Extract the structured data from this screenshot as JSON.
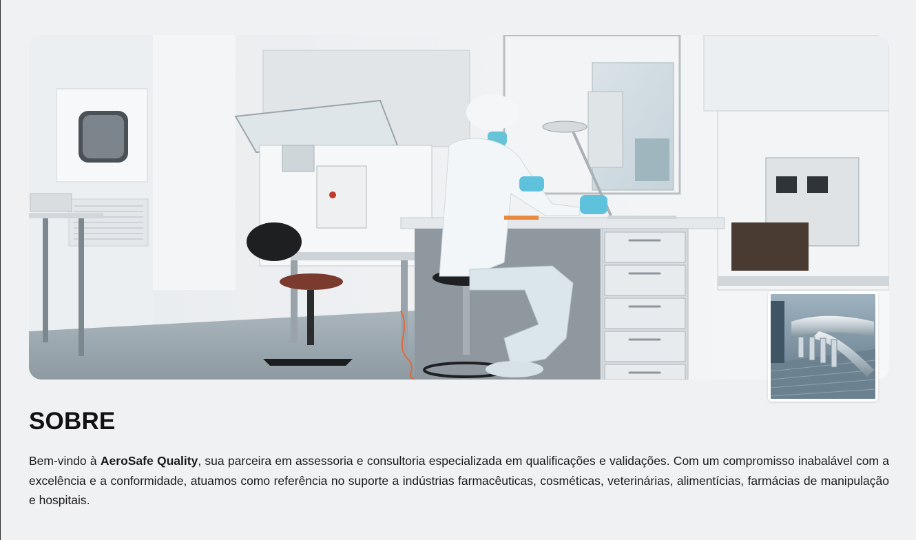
{
  "about": {
    "title": "SOBRE",
    "text_before": "Bem-vindo à ",
    "brand": "AeroSafe Quality",
    "text_after": ", sua parceira em assessoria e consultoria especializada em qualificações e validações. Com um compromisso inabalável com a excelência e a conformidade, atuamos como referência no suporte a indústrias farmacêuticas, cosméticas, veterinárias, alimentícias, farmácias de manipulação e hospitais."
  },
  "images": {
    "hero_subject": "laboratory-cleanroom-photo",
    "thumbnail_subject": "hvac-ductwork-photo"
  },
  "colors": {
    "page_background": "#f0f1f3",
    "text": "#1a1a1a",
    "title": "#111111"
  }
}
